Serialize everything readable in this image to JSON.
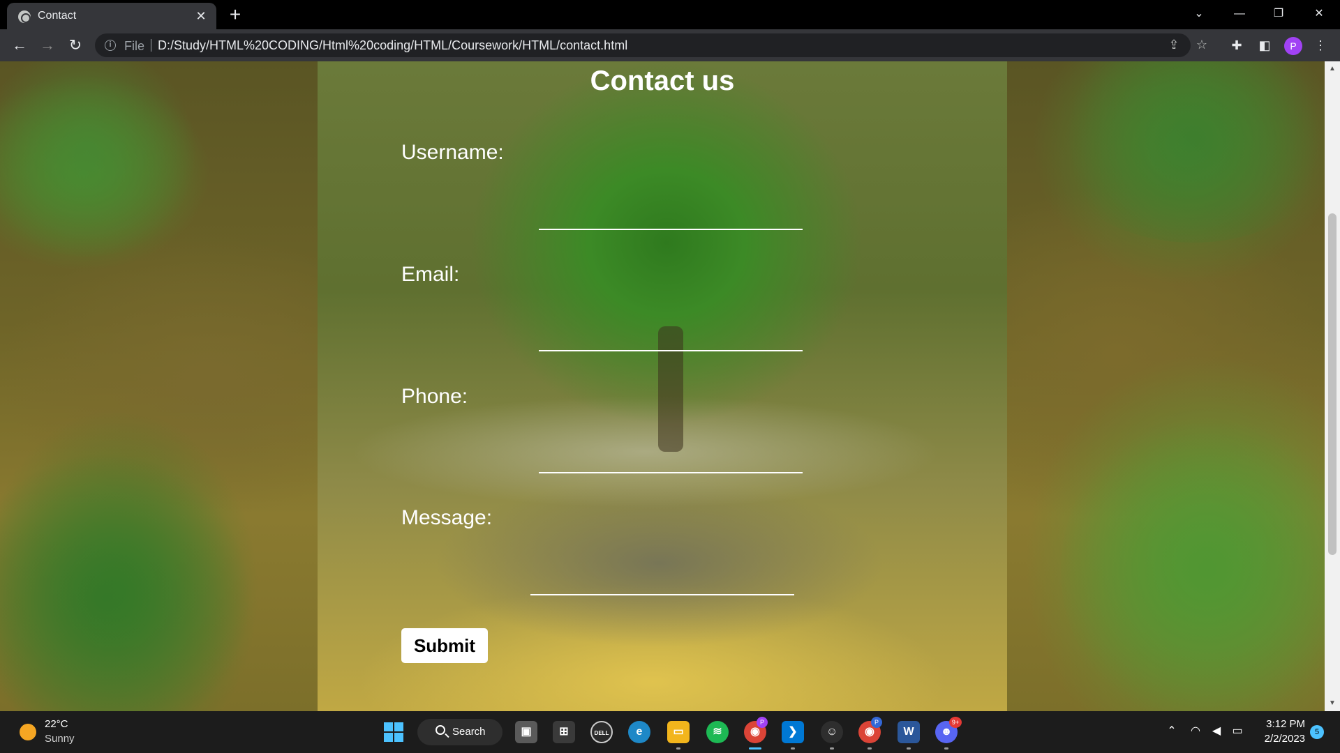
{
  "browser": {
    "tab_title": "Contact",
    "tab_close": "✕",
    "new_tab": "+",
    "file_label": "File",
    "url": "D:/Study/HTML%20CODING/Html%20coding/HTML/Coursework/HTML/contact.html"
  },
  "page": {
    "title": "Contact us",
    "fields": {
      "username_label": "Username:",
      "email_label": "Email:",
      "phone_label": "Phone:",
      "message_label": "Message:"
    },
    "submit_label": "Submit"
  },
  "taskbar": {
    "weather_temp": "22°C",
    "weather_condition": "Sunny",
    "search_label": "Search",
    "chrome_profile_badge": "P",
    "discord_badge": "9+",
    "time": "3:12 PM",
    "date": "2/2/2023",
    "notification_count": "5"
  },
  "profile": {
    "initial": "P",
    "color": "#a142f4"
  },
  "colors": {
    "accent": "#4cc2ff",
    "input_line": "#ffffff",
    "title_text": "#ffffff"
  }
}
